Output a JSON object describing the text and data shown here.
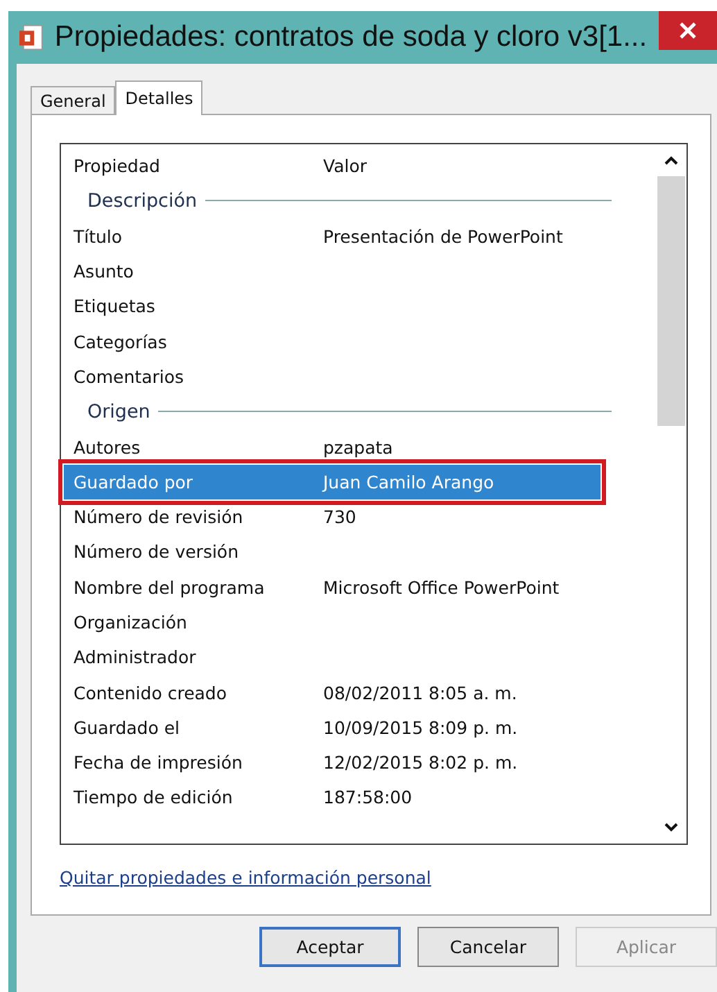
{
  "window": {
    "title": "Propiedades: contratos de soda y cloro v3[1..."
  },
  "tabs": [
    {
      "label": "General",
      "selected": false
    },
    {
      "label": "Detalles",
      "selected": true
    }
  ],
  "table": {
    "columns": [
      "Propiedad",
      "Valor"
    ],
    "rows": [
      {
        "kind": "section",
        "label": "Descripción"
      },
      {
        "kind": "property",
        "name": "Título",
        "value": "Presentación de PowerPoint",
        "selected": false,
        "marked": false
      },
      {
        "kind": "property",
        "name": "Asunto",
        "value": "",
        "selected": false,
        "marked": false
      },
      {
        "kind": "property",
        "name": "Etiquetas",
        "value": "",
        "selected": false,
        "marked": false
      },
      {
        "kind": "property",
        "name": "Categorías",
        "value": "",
        "selected": false,
        "marked": false
      },
      {
        "kind": "property",
        "name": "Comentarios",
        "value": "",
        "selected": false,
        "marked": false
      },
      {
        "kind": "section",
        "label": "Origen"
      },
      {
        "kind": "property",
        "name": "Autores",
        "value": "pzapata",
        "selected": false,
        "marked": false
      },
      {
        "kind": "property",
        "name": "Guardado por",
        "value": "Juan Camilo Arango",
        "selected": true,
        "marked": true
      },
      {
        "kind": "property",
        "name": "Número de revisión",
        "value": "730",
        "selected": false,
        "marked": false
      },
      {
        "kind": "property",
        "name": "Número de versión",
        "value": "",
        "selected": false,
        "marked": false
      },
      {
        "kind": "property",
        "name": "Nombre del programa",
        "value": "Microsoft Office PowerPoint",
        "selected": false,
        "marked": false
      },
      {
        "kind": "property",
        "name": "Organización",
        "value": "",
        "selected": false,
        "marked": false
      },
      {
        "kind": "property",
        "name": "Administrador",
        "value": "",
        "selected": false,
        "marked": false
      },
      {
        "kind": "property",
        "name": "Contenido creado",
        "value": "08/02/2011 8:05 a. m.",
        "selected": false,
        "marked": false
      },
      {
        "kind": "property",
        "name": "Guardado el",
        "value": "10/09/2015 8:09 p. m.",
        "selected": false,
        "marked": false
      },
      {
        "kind": "property",
        "name": "Fecha de impresión",
        "value": "12/02/2015 8:02 p. m.",
        "selected": false,
        "marked": false
      },
      {
        "kind": "property",
        "name": "Tiempo de edición",
        "value": "187:58:00",
        "selected": false,
        "marked": false
      }
    ]
  },
  "link": "Quitar propiedades e información personal",
  "buttons": [
    {
      "label": "Aceptar",
      "disabled": false,
      "default": true
    },
    {
      "label": "Cancelar",
      "disabled": false,
      "default": false
    },
    {
      "label": "Aplicar",
      "disabled": true,
      "default": false
    }
  ]
}
